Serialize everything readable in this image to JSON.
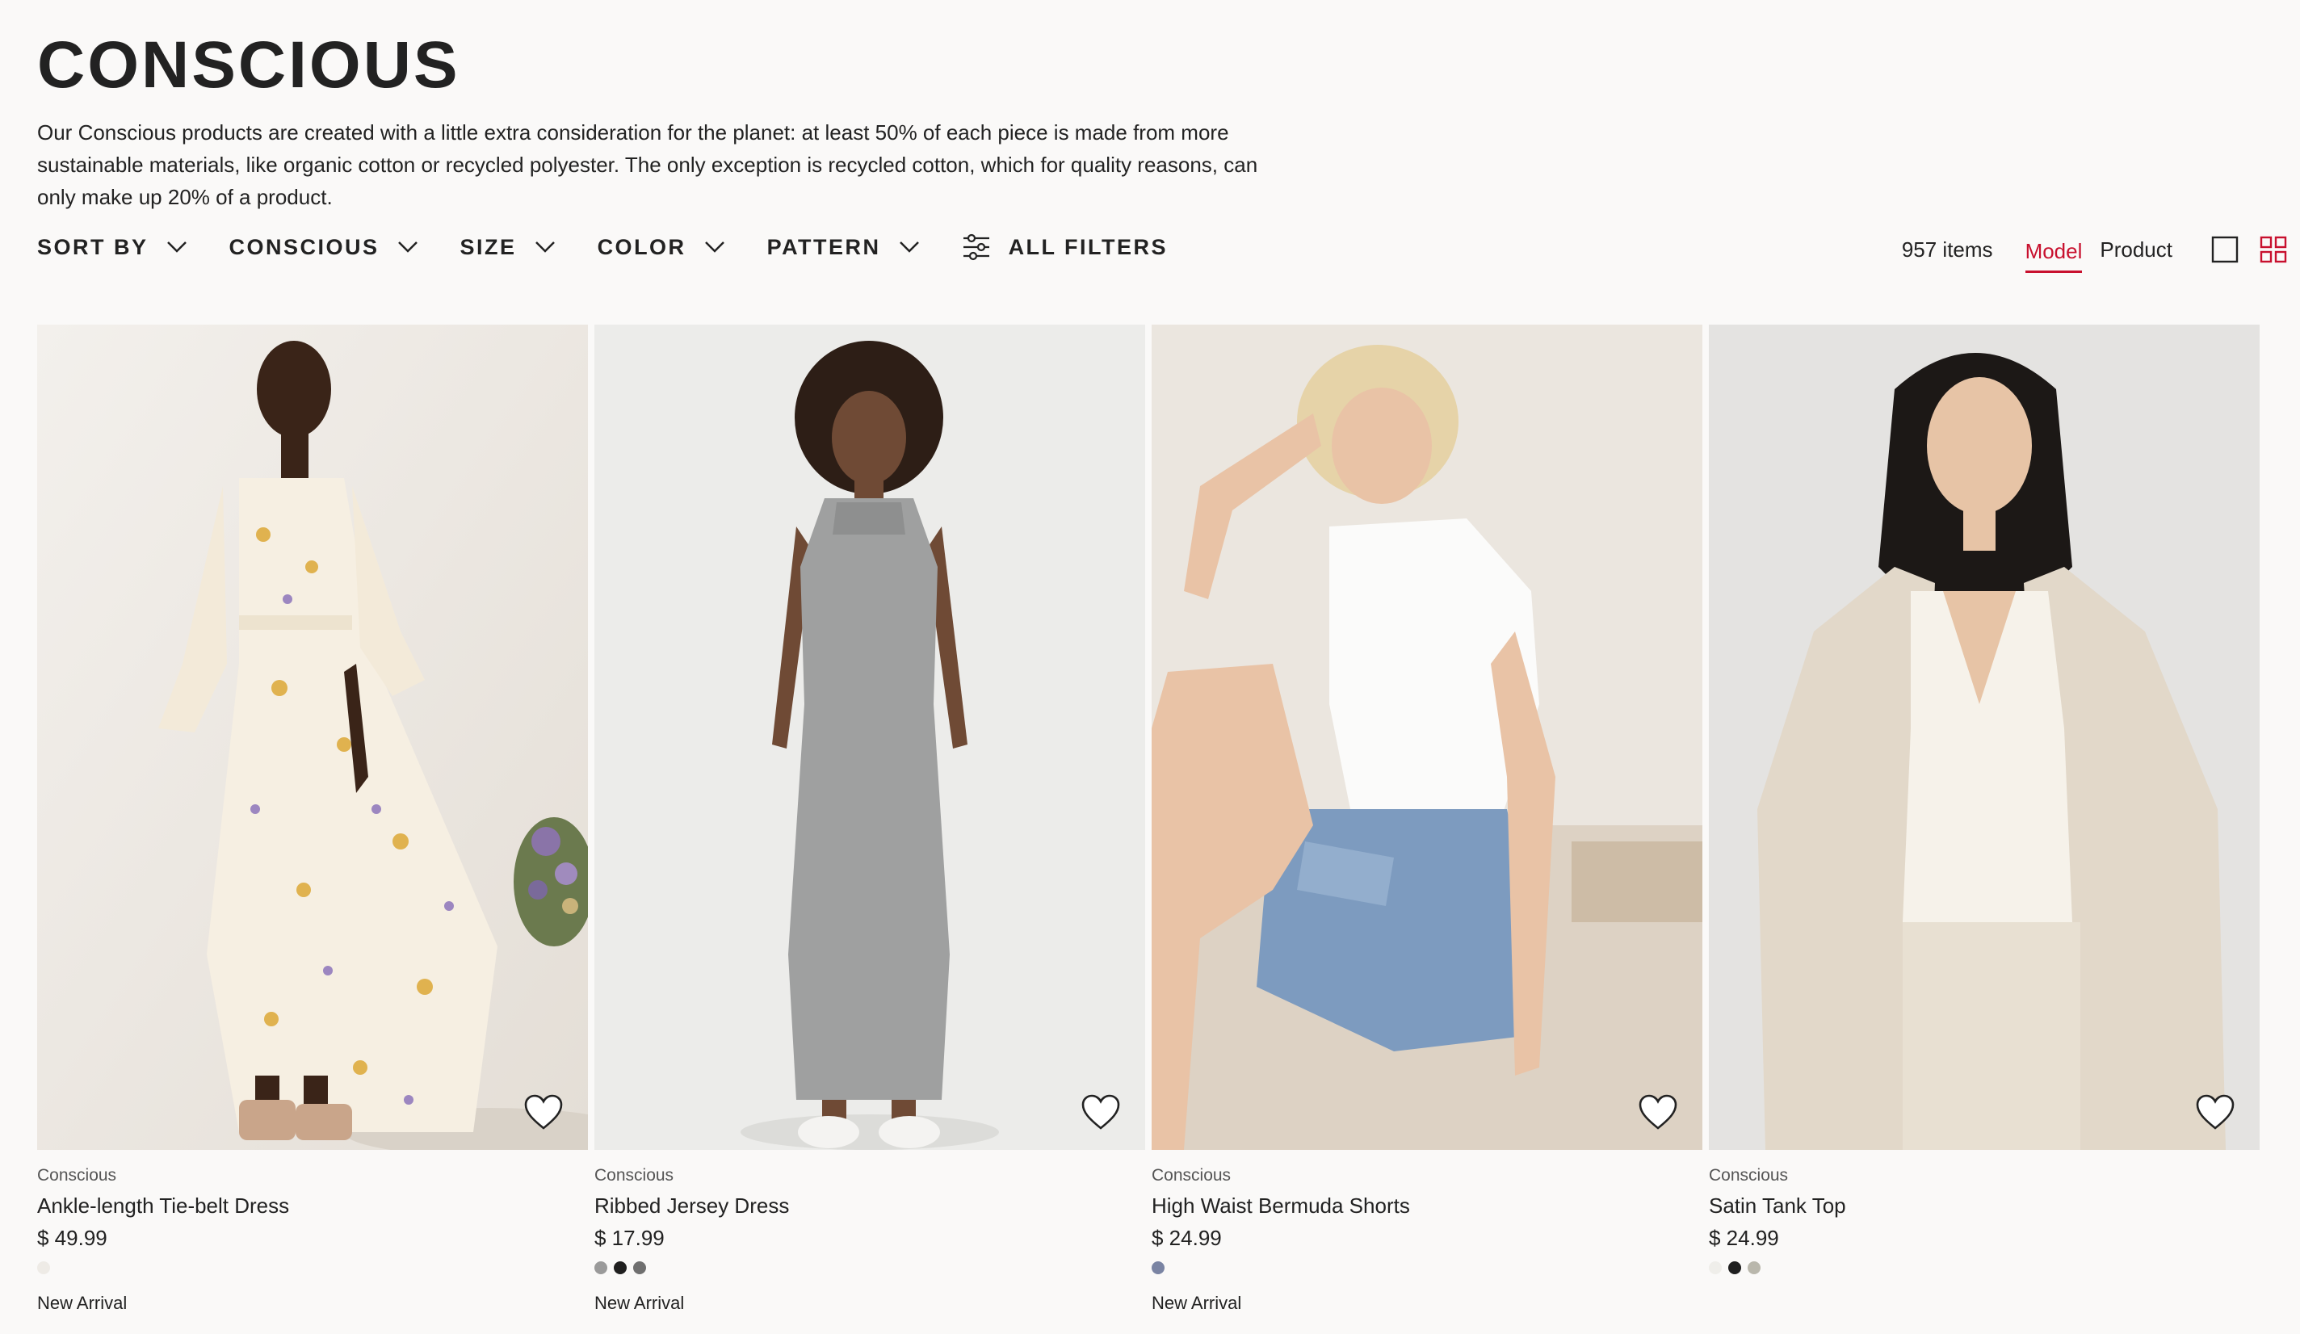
{
  "page": {
    "title": "CONSCIOUS",
    "description": "Our Conscious products are created with a little extra consideration for the planet: at least 50% of each piece is made from more sustainable materials, like organic cotton or recycled polyester. The only exception is recycled cotton, which for quality reasons, can only make up 20% of a product."
  },
  "filters": {
    "sort_by": "SORT BY",
    "conscious": "CONSCIOUS",
    "size": "SIZE",
    "color": "COLOR",
    "pattern": "PATTERN",
    "all_filters": "ALL FILTERS"
  },
  "view": {
    "count": "957 items",
    "model_tab": "Model",
    "product_tab": "Product",
    "active_tab": "Model",
    "accent_color": "#c8102e"
  },
  "products": [
    {
      "brand": "Conscious",
      "name": "Ankle-length Tie-belt Dress",
      "price": "$ 49.99",
      "swatches": [
        "#eeebe6"
      ],
      "tag": "New Arrival",
      "icon": "heart-icon"
    },
    {
      "brand": "Conscious",
      "name": "Ribbed Jersey Dress",
      "price": "$ 17.99",
      "swatches": [
        "#9a9a9a",
        "#1f1f1f",
        "#6f6f6f"
      ],
      "tag": "New Arrival",
      "icon": "heart-icon"
    },
    {
      "brand": "Conscious",
      "name": "High Waist Bermuda Shorts",
      "price": "$ 24.99",
      "swatches": [
        "#7a84a3"
      ],
      "tag": "New Arrival",
      "icon": "heart-icon"
    },
    {
      "brand": "Conscious",
      "name": "Satin Tank Top",
      "price": "$ 24.99",
      "swatches": [
        "#efeeea",
        "#1f1f1f",
        "#b9b7ac"
      ],
      "tag": "",
      "icon": "heart-icon"
    }
  ]
}
